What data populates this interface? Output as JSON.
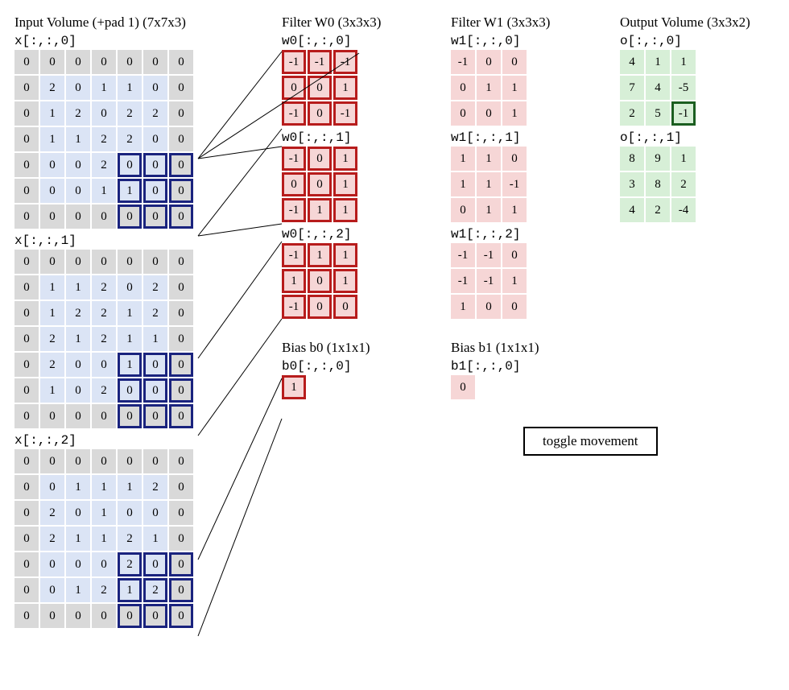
{
  "titles": {
    "input": "Input Volume (+pad 1) (7x7x3)",
    "w0": "Filter W0 (3x3x3)",
    "w1": "Filter W1 (3x3x3)",
    "out": "Output Volume (3x3x2)",
    "bias0": "Bias b0 (1x1x1)",
    "bias1": "Bias b1 (1x1x1)"
  },
  "slice_labels": {
    "x0": "x[:,:,0]",
    "x1": "x[:,:,1]",
    "x2": "x[:,:,2]",
    "w00": "w0[:,:,0]",
    "w01": "w0[:,:,1]",
    "w02": "w0[:,:,2]",
    "w10": "w1[:,:,0]",
    "w11": "w1[:,:,1]",
    "w12": "w1[:,:,2]",
    "b0": "b0[:,:,0]",
    "b1": "b1[:,:,0]",
    "o0": "o[:,:,0]",
    "o1": "o[:,:,1]"
  },
  "toggle_label": "toggle movement",
  "x": [
    [
      [
        0,
        0,
        0,
        0,
        0,
        0,
        0
      ],
      [
        0,
        2,
        0,
        1,
        1,
        0,
        0
      ],
      [
        0,
        1,
        2,
        0,
        2,
        2,
        0
      ],
      [
        0,
        1,
        1,
        2,
        2,
        0,
        0
      ],
      [
        0,
        0,
        0,
        2,
        0,
        0,
        0
      ],
      [
        0,
        0,
        0,
        1,
        1,
        0,
        0
      ],
      [
        0,
        0,
        0,
        0,
        0,
        0,
        0
      ]
    ],
    [
      [
        0,
        0,
        0,
        0,
        0,
        0,
        0
      ],
      [
        0,
        1,
        1,
        2,
        0,
        2,
        0
      ],
      [
        0,
        1,
        2,
        2,
        1,
        2,
        0
      ],
      [
        0,
        2,
        1,
        2,
        1,
        1,
        0
      ],
      [
        0,
        2,
        0,
        0,
        1,
        0,
        0
      ],
      [
        0,
        1,
        0,
        2,
        0,
        0,
        0
      ],
      [
        0,
        0,
        0,
        0,
        0,
        0,
        0
      ]
    ],
    [
      [
        0,
        0,
        0,
        0,
        0,
        0,
        0
      ],
      [
        0,
        0,
        1,
        1,
        1,
        2,
        0
      ],
      [
        0,
        2,
        0,
        1,
        0,
        0,
        0
      ],
      [
        0,
        2,
        1,
        1,
        2,
        1,
        0
      ],
      [
        0,
        0,
        0,
        0,
        2,
        0,
        0
      ],
      [
        0,
        0,
        1,
        2,
        1,
        2,
        0
      ],
      [
        0,
        0,
        0,
        0,
        0,
        0,
        0
      ]
    ]
  ],
  "w0": [
    [
      [
        -1,
        -1,
        -1
      ],
      [
        0,
        0,
        1
      ],
      [
        -1,
        0,
        -1
      ]
    ],
    [
      [
        -1,
        0,
        1
      ],
      [
        0,
        0,
        1
      ],
      [
        -1,
        1,
        1
      ]
    ],
    [
      [
        -1,
        1,
        1
      ],
      [
        1,
        0,
        1
      ],
      [
        -1,
        0,
        0
      ]
    ]
  ],
  "w1": [
    [
      [
        -1,
        0,
        0
      ],
      [
        0,
        1,
        1
      ],
      [
        0,
        0,
        1
      ]
    ],
    [
      [
        1,
        1,
        0
      ],
      [
        1,
        1,
        -1
      ],
      [
        0,
        1,
        1
      ]
    ],
    [
      [
        -1,
        -1,
        0
      ],
      [
        -1,
        -1,
        1
      ],
      [
        1,
        0,
        0
      ]
    ]
  ],
  "b0": [
    [
      1
    ]
  ],
  "b1": [
    [
      0
    ]
  ],
  "o": [
    [
      [
        4,
        1,
        1
      ],
      [
        7,
        4,
        -5
      ],
      [
        2,
        5,
        -1
      ]
    ],
    [
      [
        8,
        9,
        1
      ],
      [
        3,
        8,
        2
      ],
      [
        4,
        2,
        -4
      ]
    ]
  ],
  "highlight": {
    "input_window": {
      "row": 4,
      "col": 4,
      "size": 3
    },
    "output_cell": {
      "depth": 0,
      "row": 2,
      "col": 2
    }
  },
  "chart_data": {
    "type": "table",
    "description": "Convolution demo: three 7x7 input slices (blue, zero-padded edges gray), two 3x3x3 filters W0 (red, highlighted) and W1 (red), biases b0=1 b1=0, and 3x3x2 output volume (green). Current 3x3 receptive field is at input rows 4-6 cols 4-6 producing o[2,2,0]=-1 (highlighted).",
    "input_x": [
      [
        [
          0,
          0,
          0,
          0,
          0,
          0,
          0
        ],
        [
          0,
          2,
          0,
          1,
          1,
          0,
          0
        ],
        [
          0,
          1,
          2,
          0,
          2,
          2,
          0
        ],
        [
          0,
          1,
          1,
          2,
          2,
          0,
          0
        ],
        [
          0,
          0,
          0,
          2,
          0,
          0,
          0
        ],
        [
          0,
          0,
          0,
          1,
          1,
          0,
          0
        ],
        [
          0,
          0,
          0,
          0,
          0,
          0,
          0
        ]
      ],
      [
        [
          0,
          0,
          0,
          0,
          0,
          0,
          0
        ],
        [
          0,
          1,
          1,
          2,
          0,
          2,
          0
        ],
        [
          0,
          1,
          2,
          2,
          1,
          2,
          0
        ],
        [
          0,
          2,
          1,
          2,
          1,
          1,
          0
        ],
        [
          0,
          2,
          0,
          0,
          1,
          0,
          0
        ],
        [
          0,
          1,
          0,
          2,
          0,
          0,
          0
        ],
        [
          0,
          0,
          0,
          0,
          0,
          0,
          0
        ]
      ],
      [
        [
          0,
          0,
          0,
          0,
          0,
          0,
          0
        ],
        [
          0,
          0,
          1,
          1,
          1,
          2,
          0
        ],
        [
          0,
          2,
          0,
          1,
          0,
          0,
          0
        ],
        [
          0,
          2,
          1,
          1,
          2,
          1,
          0
        ],
        [
          0,
          0,
          0,
          0,
          2,
          0,
          0
        ],
        [
          0,
          0,
          1,
          2,
          1,
          2,
          0
        ],
        [
          0,
          0,
          0,
          0,
          0,
          0,
          0
        ]
      ]
    ],
    "filter_w0": [
      [
        [
          -1,
          -1,
          -1
        ],
        [
          0,
          0,
          1
        ],
        [
          -1,
          0,
          -1
        ]
      ],
      [
        [
          -1,
          0,
          1
        ],
        [
          0,
          0,
          1
        ],
        [
          -1,
          1,
          1
        ]
      ],
      [
        [
          -1,
          1,
          1
        ],
        [
          1,
          0,
          1
        ],
        [
          -1,
          0,
          0
        ]
      ]
    ],
    "filter_w1": [
      [
        [
          -1,
          0,
          0
        ],
        [
          0,
          1,
          1
        ],
        [
          0,
          0,
          1
        ]
      ],
      [
        [
          1,
          1,
          0
        ],
        [
          1,
          1,
          -1
        ],
        [
          0,
          1,
          1
        ]
      ],
      [
        [
          -1,
          -1,
          0
        ],
        [
          -1,
          -1,
          1
        ],
        [
          1,
          0,
          0
        ]
      ]
    ],
    "bias_b0": 1,
    "bias_b1": 0,
    "output_o": [
      [
        [
          4,
          1,
          1
        ],
        [
          7,
          4,
          -5
        ],
        [
          2,
          5,
          -1
        ]
      ],
      [
        [
          8,
          9,
          1
        ],
        [
          3,
          8,
          2
        ],
        [
          4,
          2,
          -4
        ]
      ]
    ]
  }
}
